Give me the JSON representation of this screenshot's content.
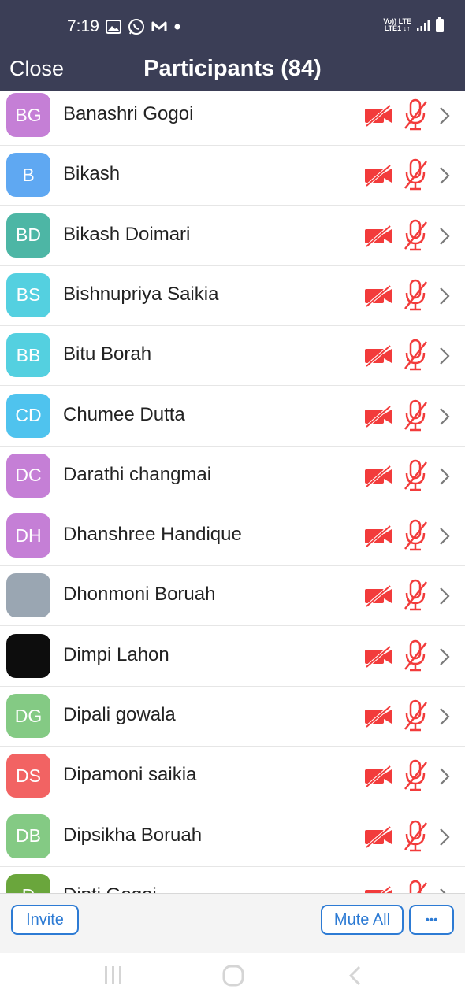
{
  "status_bar": {
    "time": "7:19",
    "network_line1": "Vo)) LTE",
    "network_line2": "LTE1 ↓↑"
  },
  "header": {
    "close_label": "Close",
    "title": "Participants (84)"
  },
  "participants": [
    {
      "initials": "BG",
      "name": "Banashri Gogoi",
      "avatar_color": "#c57fd6"
    },
    {
      "initials": "B",
      "name": "Bikash",
      "avatar_color": "#5fa8f2"
    },
    {
      "initials": "BD",
      "name": "Bikash Doimari",
      "avatar_color": "#4db6a5"
    },
    {
      "initials": "BS",
      "name": "Bishnupriya Saikia",
      "avatar_color": "#54d0e0"
    },
    {
      "initials": "BB",
      "name": "Bitu Borah",
      "avatar_color": "#54d0e0"
    },
    {
      "initials": "CD",
      "name": "Chumee Dutta",
      "avatar_color": "#4fc3ee"
    },
    {
      "initials": "DC",
      "name": "Darathi changmai",
      "avatar_color": "#c57fd6"
    },
    {
      "initials": "DH",
      "name": "Dhanshree Handique",
      "avatar_color": "#c57fd6"
    },
    {
      "initials": "",
      "name": "Dhonmoni Boruah",
      "avatar_color": "#9aa6b2",
      "avatar_icon": "person-photo"
    },
    {
      "initials": "",
      "name": "Dimpi Lahon",
      "avatar_color": "#0d0d0d",
      "avatar_icon": "flower-photo"
    },
    {
      "initials": "DG",
      "name": "Dipali gowala",
      "avatar_color": "#84ca84"
    },
    {
      "initials": "DS",
      "name": "Dipamoni saikia",
      "avatar_color": "#f26363"
    },
    {
      "initials": "DB",
      "name": "Dipsikha Boruah",
      "avatar_color": "#84ca84"
    },
    {
      "initials": "D",
      "name": "Dipti Gogoi",
      "avatar_color": "#6aa63c"
    }
  ],
  "icons": {
    "video_off": "video-off-icon",
    "mic_off": "mic-off-icon",
    "chevron": "chevron-right-icon",
    "muted_color": "#f23b3b"
  },
  "toolbar": {
    "invite_label": "Invite",
    "mute_all_label": "Mute All",
    "more_label": "•••"
  },
  "colors": {
    "header_bg": "#3b3e56",
    "accent": "#2d7bd4"
  }
}
